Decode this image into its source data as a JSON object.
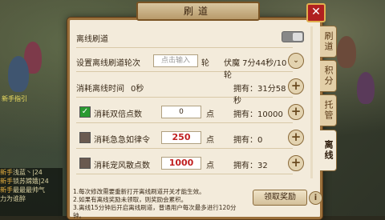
{
  "window": {
    "title": "刷道",
    "close_label": "✕"
  },
  "tabs": [
    {
      "label": "刷道"
    },
    {
      "label": "积分"
    },
    {
      "label": "托管"
    },
    {
      "label": "离线"
    }
  ],
  "rows": {
    "offline_brush": {
      "label": "离线刷道",
      "toggle": "off"
    },
    "set_rounds": {
      "label": "设置离线刷道轮次",
      "input_placeholder": "点击输入",
      "unit": "轮",
      "status": "伏魔 7分44秒/10轮"
    },
    "consume_time": {
      "label": "消耗离线时间",
      "value": "0秒",
      "owned": "拥有：31分58秒"
    },
    "double_points": {
      "label": "消耗双倍点数",
      "checked": true,
      "input_value": "0",
      "unit": "点",
      "owned": "拥有：10000"
    },
    "urgent_decree": {
      "label": "消耗急急如律令",
      "checked": false,
      "input_value": "250",
      "unit": "点",
      "owned": "拥有：0"
    },
    "pet_fengsan": {
      "label": "消耗宠风散点数",
      "checked": false,
      "input_value": "1000",
      "unit": "点",
      "owned": "拥有：32"
    }
  },
  "notes": [
    "1.每次修改需要重新打开离线刷道开关才能生效。",
    "2.如果有离线奖励未领取，则奖励会累积。",
    "3.离线15分钟后开启离线刷道，普通用户每次最多进行120分钟。"
  ],
  "buttons": {
    "claim": "领取奖励",
    "info": "i"
  },
  "chat": [
    {
      "tag": "新手",
      "text": "浅蓝丶|24"
    },
    {
      "tag": "新手",
      "text": "锁苏嫦娥|24"
    },
    {
      "tag": "新手",
      "text": "最最最帅气"
    },
    {
      "tag": "",
      "text": "力为谁醉"
    }
  ],
  "map_labels": [
    "新手指引"
  ]
}
